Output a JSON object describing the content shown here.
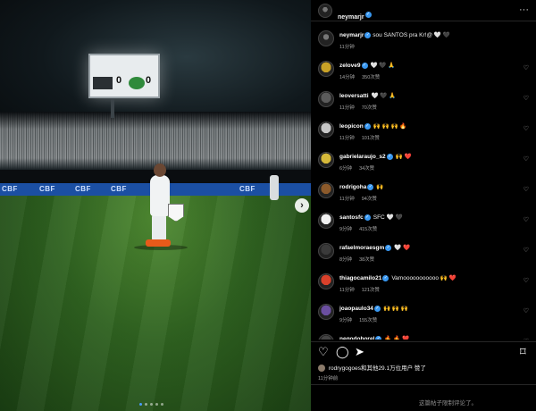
{
  "post": {
    "author": "neymarjr",
    "caption": "sou SANTOS pra Kr!@ 🤍 🖤",
    "caption_time": "11分钟",
    "photo": {
      "board_text": "CBF",
      "home_score": "0",
      "away_score": "0",
      "slide_count": 5,
      "active_slide": 1
    },
    "comments": [
      {
        "user": "zelove9",
        "verified": true,
        "text": "🤍 🖤 🙏",
        "time": "14分钟",
        "likes": "350次赞"
      },
      {
        "user": "leoversatti",
        "verified": false,
        "text": "🤍 🖤 🙏",
        "time": "11分钟",
        "likes": "70次赞"
      },
      {
        "user": "leopicon",
        "verified": true,
        "text": "🙌 🙌 🙌 🔥",
        "time": "11分钟",
        "likes": "101次赞"
      },
      {
        "user": "gabrielaraujo_s2",
        "verified": true,
        "text": "🙌 ❤️",
        "time": "6分钟",
        "likes": "34次赞"
      },
      {
        "user": "rodrigoha",
        "verified": true,
        "text": "🙌",
        "time": "11分钟",
        "likes": "94次赞"
      },
      {
        "user": "santosfc",
        "verified": true,
        "text": "SFC 🤍 🖤",
        "time": "9分钟",
        "likes": "415次赞"
      },
      {
        "user": "rafaelmoraesgm",
        "verified": true,
        "text": "🤍 ❤️",
        "time": "8分钟",
        "likes": "38次赞"
      },
      {
        "user": "thiagocamilo21",
        "verified": true,
        "text": "Vamooooooooooo 🙌 ❤️",
        "time": "11分钟",
        "likes": "121次赞"
      },
      {
        "user": "joaopaulo34",
        "verified": true,
        "text": "🙌 🙌 🙌",
        "time": "9分钟",
        "likes": "155次赞"
      },
      {
        "user": "neqodoborel",
        "verified": true,
        "text": "🔥 🔥 ❤️",
        "time": "",
        "likes": ""
      }
    ],
    "likes_line": "rodrygogoes和其他29.1万位用户 赞了",
    "posted_time": "11分钟前",
    "comments_disabled": "这篇帖子限制评论了。"
  },
  "icons": {
    "heart": "♡",
    "comment": "◯",
    "share": "➤",
    "bookmark": "⌑",
    "more": "···",
    "next": "›"
  },
  "colors": {
    "verified": "#3897f0",
    "active_dot": "#4a9bff"
  }
}
